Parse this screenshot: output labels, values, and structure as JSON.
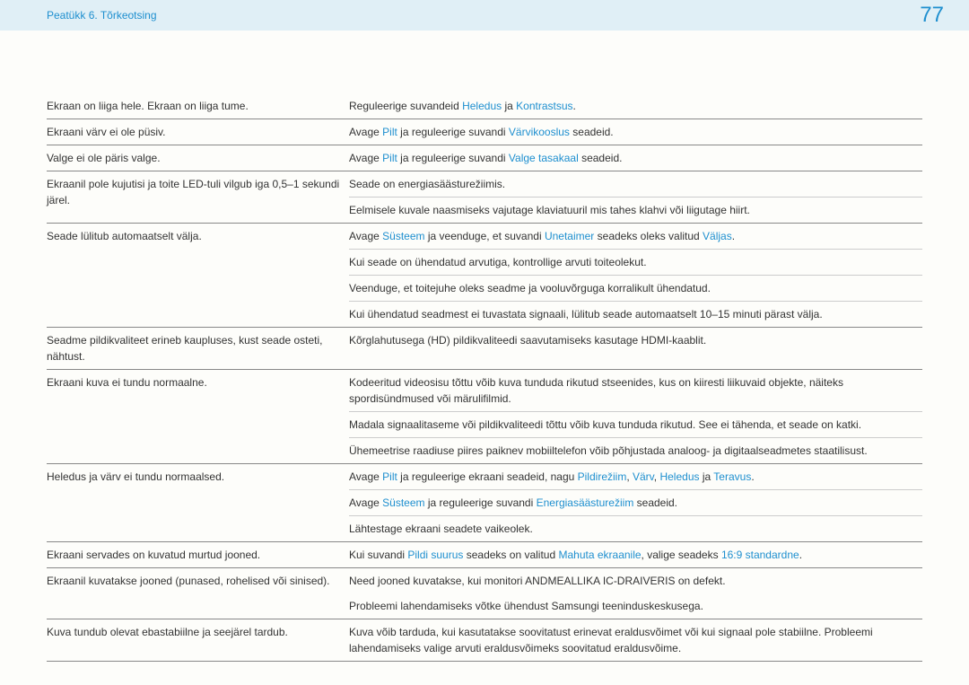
{
  "header": {
    "chapter": "Peatükk 6. Tõrkeotsing",
    "page": "77"
  },
  "rows": [
    {
      "l": "Ekraan on liiga hele. Ekraan on liiga tume.",
      "r": [
        {
          "t": "Reguleerige suvandeid "
        },
        {
          "t": "Heledus",
          "h": 1
        },
        {
          "t": " ja "
        },
        {
          "t": "Kontrastsus",
          "h": 1
        },
        {
          "t": "."
        }
      ],
      "lb": "solid",
      "rb": "solid"
    },
    {
      "l": "Ekraani värv ei ole püsiv.",
      "r": [
        {
          "t": "Avage "
        },
        {
          "t": "Pilt",
          "h": 1
        },
        {
          "t": " ja reguleerige suvandi "
        },
        {
          "t": "Värvikooslus",
          "h": 1
        },
        {
          "t": " seadeid."
        }
      ],
      "lb": "solid",
      "rb": "solid"
    },
    {
      "l": "Valge ei ole päris valge.",
      "r": [
        {
          "t": "Avage "
        },
        {
          "t": "Pilt",
          "h": 1
        },
        {
          "t": " ja reguleerige suvandi "
        },
        {
          "t": "Valge tasakaal",
          "h": 1
        },
        {
          "t": " seadeid."
        }
      ],
      "lb": "solid",
      "rb": "solid"
    },
    {
      "l": "Ekraanil pole kujutisi ja toite LED-tuli vilgub iga 0,5–1 sekundi järel.",
      "r": [
        {
          "t": "Seade on energiasäästurežiimis."
        }
      ],
      "lb": "none",
      "rb": "thin",
      "lrows": 2
    },
    {
      "l": "",
      "r": [
        {
          "t": "Eelmisele kuvale naasmiseks vajutage klaviatuuril mis tahes klahvi või liigutage hiirt."
        }
      ],
      "lb": "solid",
      "rb": "solid",
      "skipL": true
    },
    {
      "l": "Seade lülitub automaatselt välja.",
      "r": [
        {
          "t": "Avage "
        },
        {
          "t": "Süsteem",
          "h": 1
        },
        {
          "t": " ja veenduge, et suvandi "
        },
        {
          "t": "Unetaimer",
          "h": 1
        },
        {
          "t": " seadeks oleks valitud "
        },
        {
          "t": "Väljas",
          "h": 1
        },
        {
          "t": "."
        }
      ],
      "lb": "none",
      "rb": "thin",
      "lrows": 4
    },
    {
      "l": "",
      "r": [
        {
          "t": "Kui seade on ühendatud arvutiga, kontrollige arvuti toiteolekut."
        }
      ],
      "lb": "none",
      "rb": "thin",
      "skipL": true
    },
    {
      "l": "",
      "r": [
        {
          "t": "Veenduge, et toitejuhe oleks seadme ja vooluvõrguga korralikult ühendatud."
        }
      ],
      "lb": "none",
      "rb": "thin",
      "skipL": true
    },
    {
      "l": "",
      "r": [
        {
          "t": "Kui ühendatud seadmest ei tuvastata signaali, lülitub seade automaatselt 10–15 minuti pärast välja."
        }
      ],
      "lb": "solid",
      "rb": "solid",
      "skipL": true
    },
    {
      "l": "Seadme pildikvaliteet erineb kaupluses, kust seade osteti, nähtust.",
      "r": [
        {
          "t": "Kõrglahutusega (HD) pildikvaliteedi saavutamiseks kasutage HDMI-kaablit."
        }
      ],
      "lb": "solid",
      "rb": "solid"
    },
    {
      "l": "Ekraani kuva ei tundu normaalne.",
      "r": [
        {
          "t": "Kodeeritud videosisu tõttu võib kuva tunduda rikutud stseenides, kus on kiiresti liikuvaid objekte, näiteks spordisündmused või märulifilmid."
        }
      ],
      "lb": "none",
      "rb": "thin",
      "lrows": 3
    },
    {
      "l": "",
      "r": [
        {
          "t": "Madala signaalitaseme või pildikvaliteedi tõttu võib kuva tunduda rikutud. See ei tähenda, et seade on katki."
        }
      ],
      "lb": "none",
      "rb": "thin",
      "skipL": true
    },
    {
      "l": "",
      "r": [
        {
          "t": "Ühemeetrise raadiuse piires paiknev mobiiltelefon võib põhjustada analoog- ja digitaalseadmetes staatilisust."
        }
      ],
      "lb": "solid",
      "rb": "solid",
      "skipL": true
    },
    {
      "l": "Heledus ja värv ei tundu normaalsed.",
      "r": [
        {
          "t": "Avage "
        },
        {
          "t": "Pilt",
          "h": 1
        },
        {
          "t": " ja reguleerige ekraani seadeid, nagu "
        },
        {
          "t": "Pildirežiim",
          "h": 1
        },
        {
          "t": ", "
        },
        {
          "t": "Värv",
          "h": 1
        },
        {
          "t": ", "
        },
        {
          "t": "Heledus",
          "h": 1
        },
        {
          "t": " ja "
        },
        {
          "t": "Teravus",
          "h": 1
        },
        {
          "t": "."
        }
      ],
      "lb": "none",
      "rb": "thin",
      "lrows": 3
    },
    {
      "l": "",
      "r": [
        {
          "t": "Avage "
        },
        {
          "t": "Süsteem",
          "h": 1
        },
        {
          "t": " ja reguleerige suvandi "
        },
        {
          "t": "Energiasäästurežiim",
          "h": 1
        },
        {
          "t": " seadeid."
        }
      ],
      "lb": "none",
      "rb": "thin",
      "skipL": true
    },
    {
      "l": "",
      "r": [
        {
          "t": "Lähtestage ekraani seadete vaikeolek."
        }
      ],
      "lb": "solid",
      "rb": "solid",
      "skipL": true
    },
    {
      "l": "Ekraani servades on kuvatud murtud jooned.",
      "r": [
        {
          "t": "Kui suvandi "
        },
        {
          "t": "Pildi suurus",
          "h": 1
        },
        {
          "t": " seadeks on valitud "
        },
        {
          "t": "Mahuta ekraanile",
          "h": 1
        },
        {
          "t": ", valige seadeks "
        },
        {
          "t": "16:9 standardne",
          "h": 1
        },
        {
          "t": "."
        }
      ],
      "lb": "solid",
      "rb": "solid"
    },
    {
      "l": "Ekraanil kuvatakse jooned (punased, rohelised või sinised).",
      "r": [
        {
          "t": "Need jooned kuvatakse, kui monitori ANDMEALLIKA IC-DRAIVERIS on defekt."
        }
      ],
      "lb": "none",
      "rb": "none",
      "lrows": 2
    },
    {
      "l": "",
      "r": [
        {
          "t": "Probleemi lahendamiseks võtke ühendust Samsungi teeninduskeskusega."
        }
      ],
      "lb": "solid",
      "rb": "solid",
      "skipL": true
    },
    {
      "l": "Kuva tundub olevat ebastabiilne ja seejärel tardub.",
      "r": [
        {
          "t": "Kuva võib tarduda, kui kasutatakse soovitatust erinevat eraldusvõimet või kui signaal pole stabiilne. Probleemi lahendamiseks valige arvuti eraldusvõimeks soovitatud eraldusvõime."
        }
      ],
      "lb": "solid",
      "rb": "solid"
    }
  ]
}
